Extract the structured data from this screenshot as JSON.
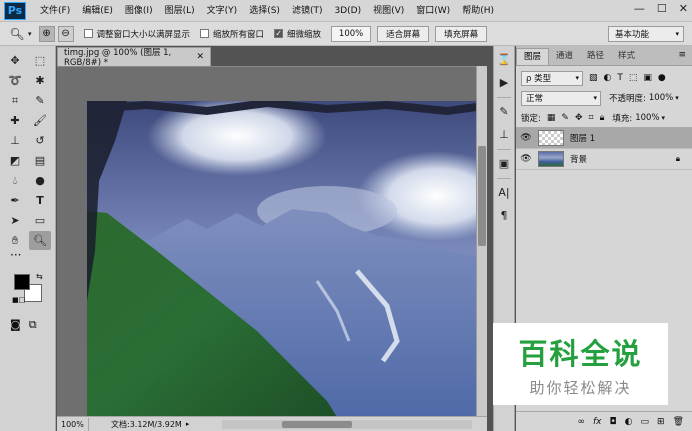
{
  "app": {
    "logo": "Ps"
  },
  "menu": [
    "文件(F)",
    "编辑(E)",
    "图像(I)",
    "图层(L)",
    "文字(Y)",
    "选择(S)",
    "滤镜(T)",
    "3D(D)",
    "视图(V)",
    "窗口(W)",
    "帮助(H)"
  ],
  "window_controls": {
    "minimize": "—",
    "restore": "☐",
    "close": "✕"
  },
  "options": {
    "resize_windows_label": "调整窗口大小以满屏显示",
    "resize_windows_checked": false,
    "zoom_all_label": "缩放所有窗口",
    "zoom_all_checked": false,
    "scrubby_zoom_label": "细微缩放",
    "scrubby_zoom_checked": true,
    "zoom_value": "100%",
    "fit_screen": "适合屏幕",
    "fill_screen": "填充屏幕",
    "workspace": "基本功能"
  },
  "document": {
    "tab_title": "timg.jpg @ 100% (图层 1, RGB/8#) *",
    "zoom": "100%",
    "info": "文档:3.12M/3.92M"
  },
  "panel": {
    "tabs": [
      "图层",
      "通道",
      "路径",
      "样式"
    ],
    "filter_kind": "ρ 类型",
    "blend_mode": "正常",
    "opacity_label": "不透明度:",
    "opacity_value": "100%",
    "lock_label": "锁定:",
    "fill_label": "填充:",
    "fill_value": "100%",
    "layers": [
      {
        "name": "图层 1",
        "selected": true,
        "locked": false
      },
      {
        "name": "背景",
        "selected": false,
        "locked": true
      }
    ]
  },
  "watermark": {
    "title": "百科全说",
    "subtitle": "助你轻松解决"
  },
  "colors": {
    "foreground": "#000000",
    "background": "#ffffff",
    "watermark_green": "#24a03e"
  }
}
